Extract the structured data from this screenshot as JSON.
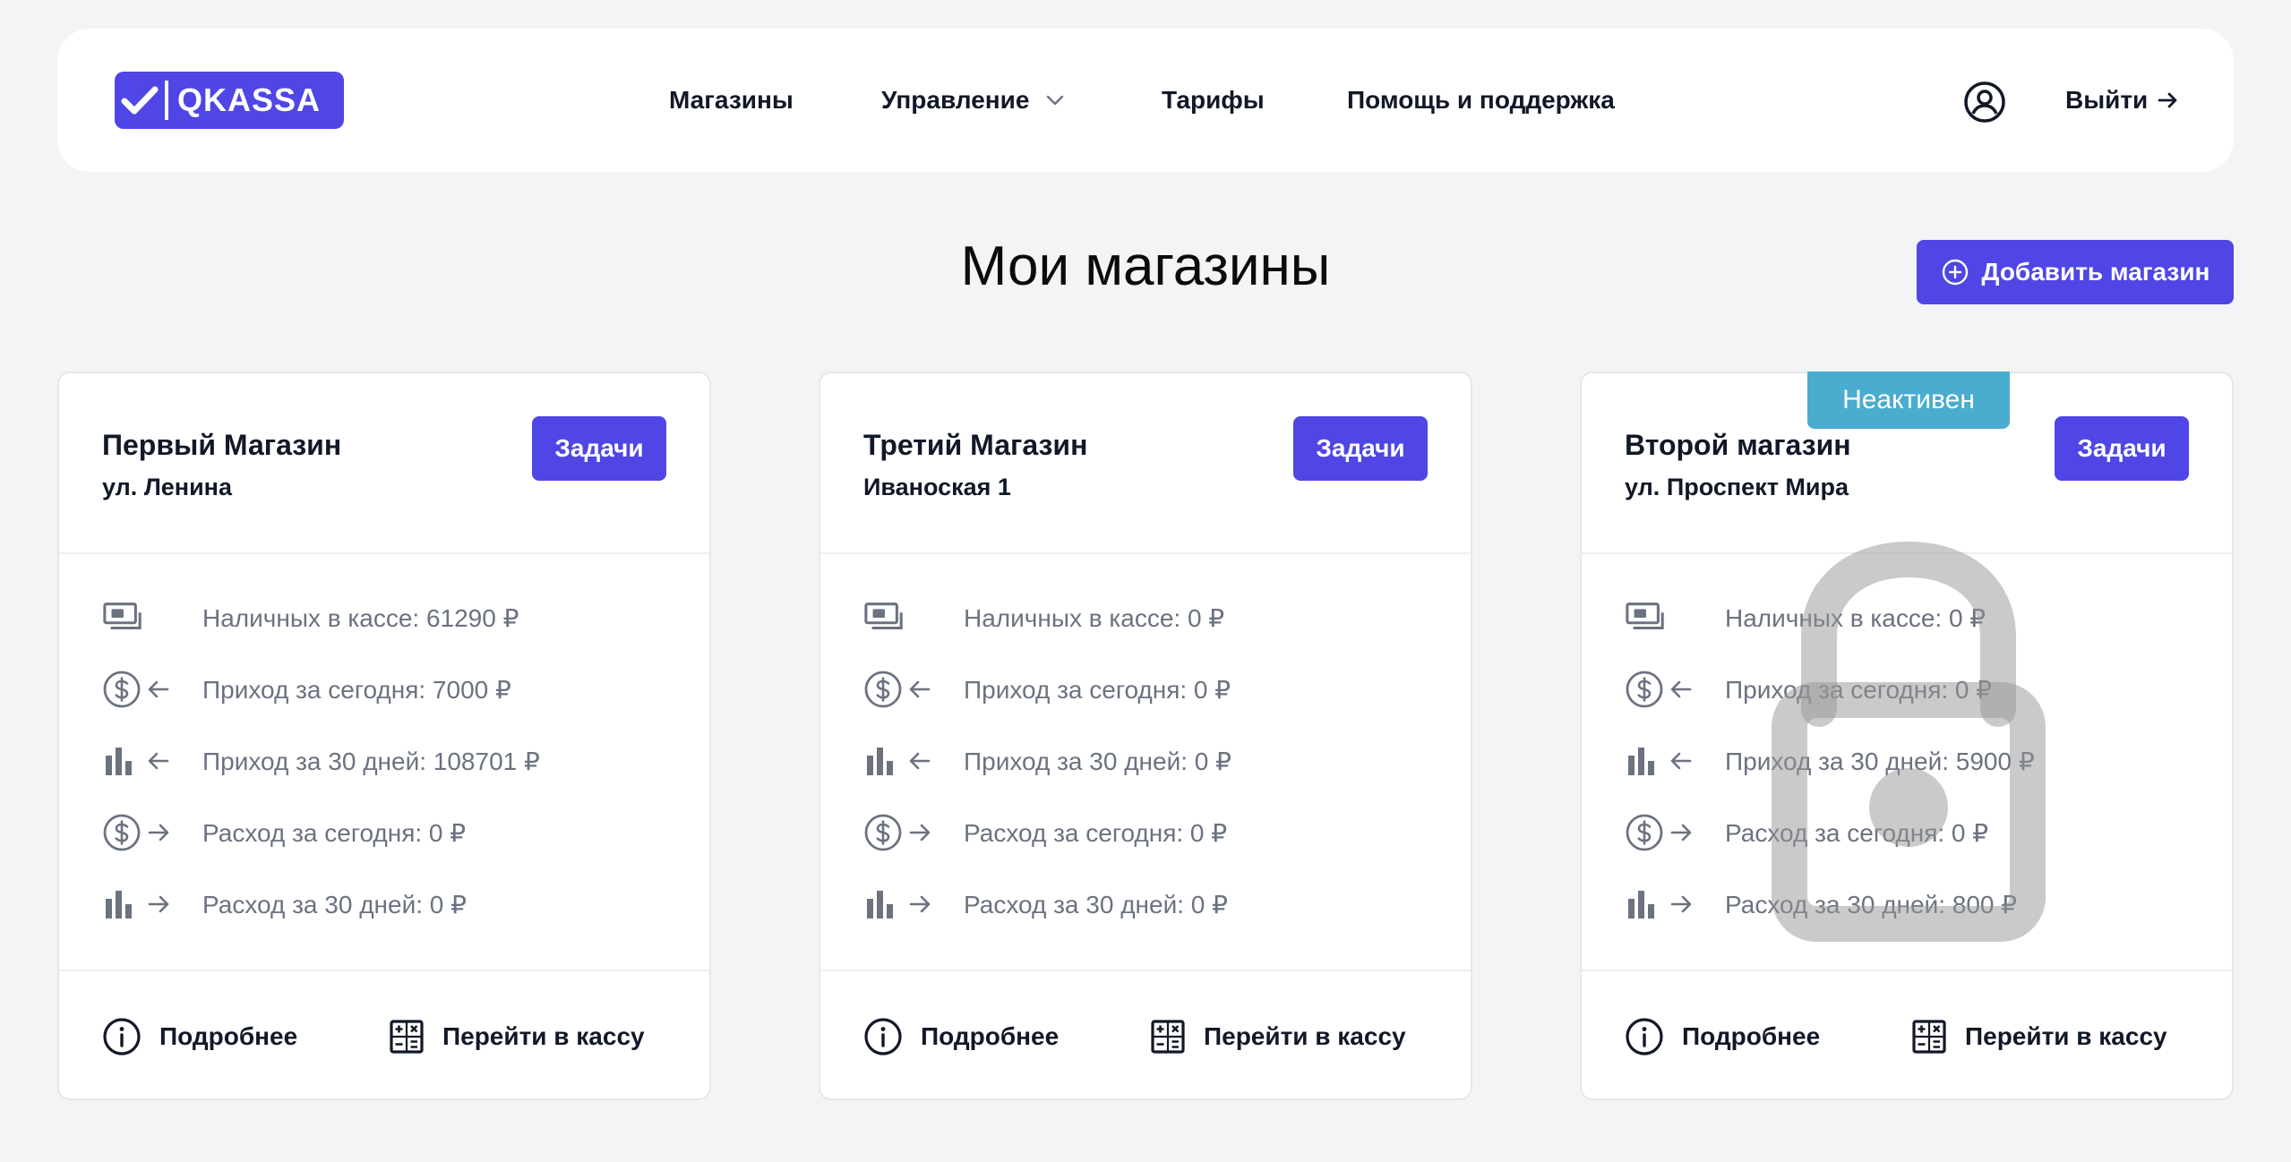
{
  "header": {
    "logo_text": "QKASSA",
    "nav": [
      {
        "label": "Магазины"
      },
      {
        "label": "Управление"
      },
      {
        "label": "Тарифы"
      },
      {
        "label": "Помощь и поддержка"
      }
    ],
    "logout_label": "Выйти"
  },
  "page": {
    "title": "Мои магазины",
    "add_button_label": "Добавить магазин"
  },
  "colors": {
    "accent": "#4f46e5",
    "inactive_badge": "#4aaccf",
    "background": "#f3f4f6"
  },
  "stores": [
    {
      "name": "Первый Магазин",
      "address": "ул. Ленина",
      "tasks_label": "Задачи",
      "stats": [
        {
          "icon": "cash-icon",
          "text": "Наличных в кассе: 61290 ₽"
        },
        {
          "icon": "income-today-icon",
          "text": "Приход за сегодня: 7000 ₽"
        },
        {
          "icon": "income-month-icon",
          "text": "Приход за 30 дней: 108701 ₽"
        },
        {
          "icon": "expense-today-icon",
          "text": "Расход за сегодня: 0 ₽"
        },
        {
          "icon": "expense-month-icon",
          "text": "Расход за 30 дней: 0 ₽"
        }
      ],
      "details_label": "Подробнее",
      "register_label": "Перейти в кассу"
    },
    {
      "name": "Третий Магазин",
      "address": "Иваноская 1",
      "tasks_label": "Задачи",
      "stats": [
        {
          "icon": "cash-icon",
          "text": "Наличных в кассе: 0 ₽"
        },
        {
          "icon": "income-today-icon",
          "text": "Приход за сегодня: 0 ₽"
        },
        {
          "icon": "income-month-icon",
          "text": "Приход за 30 дней: 0 ₽"
        },
        {
          "icon": "expense-today-icon",
          "text": "Расход за сегодня: 0 ₽"
        },
        {
          "icon": "expense-month-icon",
          "text": "Расход за 30 дней: 0 ₽"
        }
      ],
      "details_label": "Подробнее",
      "register_label": "Перейти в кассу"
    },
    {
      "name": "Второй магазин",
      "address": "ул. Проспект Мира",
      "badge": "Неактивен",
      "tasks_label": "Задачи",
      "stats": [
        {
          "icon": "cash-icon",
          "text": "Наличных в кассе: 0 ₽"
        },
        {
          "icon": "income-today-icon",
          "text": "Приход за сегодня: 0 ₽"
        },
        {
          "icon": "income-month-icon",
          "text": "Приход за 30 дней: 5900 ₽"
        },
        {
          "icon": "expense-today-icon",
          "text": "Расход за сегодня: 0 ₽"
        },
        {
          "icon": "expense-month-icon",
          "text": "Расход за 30 дней: 800 ₽"
        }
      ],
      "details_label": "Подробнее",
      "register_label": "Перейти в кассу"
    }
  ]
}
